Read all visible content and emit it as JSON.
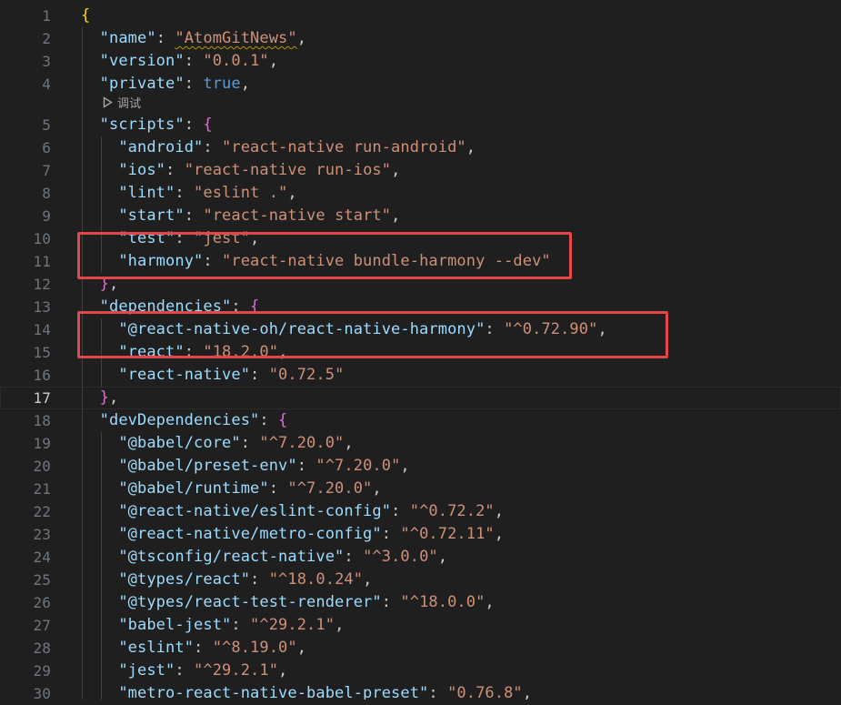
{
  "lines": [
    {
      "num": "1",
      "indent": 0,
      "tokens": [
        [
          "b1",
          "{"
        ]
      ]
    },
    {
      "num": "2",
      "indent": 1,
      "tokens": [
        [
          "k",
          "\"name\""
        ],
        [
          "p",
          ": "
        ],
        [
          "s squiggle",
          "\"AtomGitNews\""
        ],
        [
          "p",
          ","
        ]
      ]
    },
    {
      "num": "3",
      "indent": 1,
      "tokens": [
        [
          "k",
          "\"version\""
        ],
        [
          "p",
          ": "
        ],
        [
          "s",
          "\"0.0.1\""
        ],
        [
          "p",
          ","
        ]
      ]
    },
    {
      "num": "4",
      "indent": 1,
      "tokens": [
        [
          "k",
          "\"private\""
        ],
        [
          "p",
          ": "
        ],
        [
          "kw",
          "true"
        ],
        [
          "p",
          ","
        ]
      ]
    },
    {
      "codelens": "调试"
    },
    {
      "num": "5",
      "indent": 1,
      "tokens": [
        [
          "k",
          "\"scripts\""
        ],
        [
          "p",
          ": "
        ],
        [
          "b2",
          "{"
        ]
      ]
    },
    {
      "num": "6",
      "indent": 2,
      "tokens": [
        [
          "k",
          "\"android\""
        ],
        [
          "p",
          ": "
        ],
        [
          "s",
          "\"react-native run-android\""
        ],
        [
          "p",
          ","
        ]
      ]
    },
    {
      "num": "7",
      "indent": 2,
      "tokens": [
        [
          "k",
          "\"ios\""
        ],
        [
          "p",
          ": "
        ],
        [
          "s",
          "\"react-native run-ios\""
        ],
        [
          "p",
          ","
        ]
      ]
    },
    {
      "num": "8",
      "indent": 2,
      "tokens": [
        [
          "k",
          "\"lint\""
        ],
        [
          "p",
          ": "
        ],
        [
          "s",
          "\"eslint .\""
        ],
        [
          "p",
          ","
        ]
      ]
    },
    {
      "num": "9",
      "indent": 2,
      "tokens": [
        [
          "k",
          "\"start\""
        ],
        [
          "p",
          ": "
        ],
        [
          "s",
          "\"react-native start\""
        ],
        [
          "p",
          ","
        ]
      ]
    },
    {
      "num": "10",
      "indent": 2,
      "tokens": [
        [
          "k",
          "\"test\""
        ],
        [
          "p",
          ": "
        ],
        [
          "s",
          "\"jest\""
        ],
        [
          "p",
          ","
        ]
      ]
    },
    {
      "num": "11",
      "indent": 2,
      "tokens": [
        [
          "k",
          "\"harmony\""
        ],
        [
          "p",
          ": "
        ],
        [
          "s",
          "\"react-native bundle-harmony --dev\""
        ]
      ]
    },
    {
      "num": "12",
      "indent": 1,
      "tokens": [
        [
          "b2",
          "}"
        ],
        [
          "p",
          ","
        ]
      ]
    },
    {
      "num": "13",
      "indent": 1,
      "tokens": [
        [
          "k",
          "\"dependencies\""
        ],
        [
          "p",
          ": "
        ],
        [
          "b2",
          "{"
        ]
      ]
    },
    {
      "num": "14",
      "indent": 2,
      "tokens": [
        [
          "k",
          "\"@react-native-oh/react-native-harmony\""
        ],
        [
          "p",
          ": "
        ],
        [
          "s",
          "\"^0.72.90\""
        ],
        [
          "p",
          ","
        ]
      ]
    },
    {
      "num": "15",
      "indent": 2,
      "tokens": [
        [
          "k",
          "\"react\""
        ],
        [
          "p",
          ": "
        ],
        [
          "s",
          "\"18.2.0\""
        ],
        [
          "p",
          ","
        ]
      ]
    },
    {
      "num": "16",
      "indent": 2,
      "tokens": [
        [
          "k",
          "\"react-native\""
        ],
        [
          "p",
          ": "
        ],
        [
          "s",
          "\"0.72.5\""
        ]
      ]
    },
    {
      "num": "17",
      "indent": 1,
      "current": true,
      "tokens": [
        [
          "b2",
          "}"
        ],
        [
          "p",
          ","
        ]
      ]
    },
    {
      "num": "18",
      "indent": 1,
      "tokens": [
        [
          "k",
          "\"devDependencies\""
        ],
        [
          "p",
          ": "
        ],
        [
          "b2",
          "{"
        ]
      ]
    },
    {
      "num": "19",
      "indent": 2,
      "tokens": [
        [
          "k",
          "\"@babel/core\""
        ],
        [
          "p",
          ": "
        ],
        [
          "s",
          "\"^7.20.0\""
        ],
        [
          "p",
          ","
        ]
      ]
    },
    {
      "num": "20",
      "indent": 2,
      "tokens": [
        [
          "k",
          "\"@babel/preset-env\""
        ],
        [
          "p",
          ": "
        ],
        [
          "s",
          "\"^7.20.0\""
        ],
        [
          "p",
          ","
        ]
      ]
    },
    {
      "num": "21",
      "indent": 2,
      "tokens": [
        [
          "k",
          "\"@babel/runtime\""
        ],
        [
          "p",
          ": "
        ],
        [
          "s",
          "\"^7.20.0\""
        ],
        [
          "p",
          ","
        ]
      ]
    },
    {
      "num": "22",
      "indent": 2,
      "tokens": [
        [
          "k",
          "\"@react-native/eslint-config\""
        ],
        [
          "p",
          ": "
        ],
        [
          "s",
          "\"^0.72.2\""
        ],
        [
          "p",
          ","
        ]
      ]
    },
    {
      "num": "23",
      "indent": 2,
      "tokens": [
        [
          "k",
          "\"@react-native/metro-config\""
        ],
        [
          "p",
          ": "
        ],
        [
          "s",
          "\"^0.72.11\""
        ],
        [
          "p",
          ","
        ]
      ]
    },
    {
      "num": "24",
      "indent": 2,
      "tokens": [
        [
          "k",
          "\"@tsconfig/react-native\""
        ],
        [
          "p",
          ": "
        ],
        [
          "s",
          "\"^3.0.0\""
        ],
        [
          "p",
          ","
        ]
      ]
    },
    {
      "num": "25",
      "indent": 2,
      "tokens": [
        [
          "k",
          "\"@types/react\""
        ],
        [
          "p",
          ": "
        ],
        [
          "s",
          "\"^18.0.24\""
        ],
        [
          "p",
          ","
        ]
      ]
    },
    {
      "num": "26",
      "indent": 2,
      "tokens": [
        [
          "k",
          "\"@types/react-test-renderer\""
        ],
        [
          "p",
          ": "
        ],
        [
          "s",
          "\"^18.0.0\""
        ],
        [
          "p",
          ","
        ]
      ]
    },
    {
      "num": "27",
      "indent": 2,
      "tokens": [
        [
          "k",
          "\"babel-jest\""
        ],
        [
          "p",
          ": "
        ],
        [
          "s",
          "\"^29.2.1\""
        ],
        [
          "p",
          ","
        ]
      ]
    },
    {
      "num": "28",
      "indent": 2,
      "tokens": [
        [
          "k",
          "\"eslint\""
        ],
        [
          "p",
          ": "
        ],
        [
          "s",
          "\"^8.19.0\""
        ],
        [
          "p",
          ","
        ]
      ]
    },
    {
      "num": "29",
      "indent": 2,
      "tokens": [
        [
          "k",
          "\"jest\""
        ],
        [
          "p",
          ": "
        ],
        [
          "s",
          "\"^29.2.1\""
        ],
        [
          "p",
          ","
        ]
      ]
    },
    {
      "num": "30",
      "indent": 2,
      "tokens": [
        [
          "k",
          "\"metro-react-native-babel-preset\""
        ],
        [
          "p",
          ": "
        ],
        [
          "s",
          "\"0.76.8\""
        ],
        [
          "p",
          ","
        ]
      ]
    }
  ],
  "annotations": {
    "box_1_label": "harmony script highlight",
    "box_2_label": "react-native-harmony dependency highlight"
  },
  "colors": {
    "background": "#1f1f1f",
    "key": "#9cdcfe",
    "string": "#ce9178",
    "keyword": "#569cd6",
    "bracket_level_1": "#ffd700",
    "bracket_level_2": "#da70d6",
    "highlight_border": "#e5464a"
  }
}
